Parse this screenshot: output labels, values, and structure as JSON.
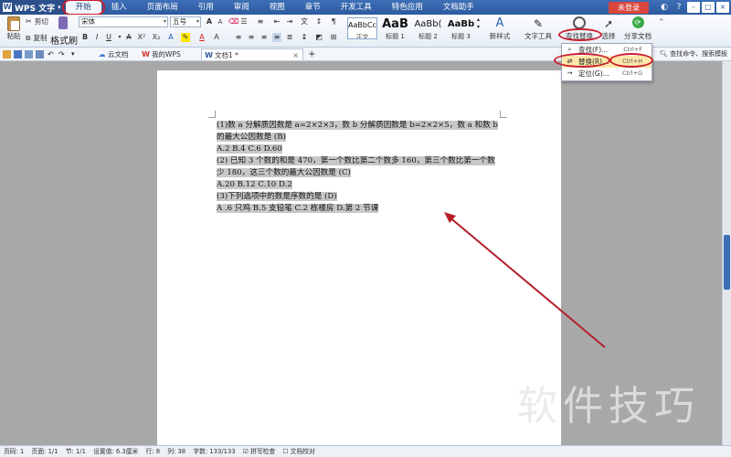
{
  "titlebar": {
    "app_name": "WPS 文字",
    "tabs": [
      "开始",
      "插入",
      "页面布局",
      "引用",
      "审阅",
      "视图",
      "章节",
      "开发工具",
      "特色应用",
      "文档助手"
    ],
    "login": "未登录"
  },
  "ribbon": {
    "paste": "粘贴",
    "cut": "剪切",
    "copy": "复制",
    "format_painter": "格式刷",
    "font_name": "宋体",
    "font_size": "五号",
    "styles": [
      {
        "preview": "AaBbCcD",
        "caption": "正文"
      },
      {
        "preview": "AaB",
        "caption": "标题 1"
      },
      {
        "preview": "AaBb(",
        "caption": "标题 2"
      },
      {
        "preview": "AaBb",
        "caption": "标题 3"
      }
    ],
    "new_style": "新样式",
    "text_tools": "文字工具",
    "find_replace": "查找替换",
    "select": "选择",
    "share_doc": "分享文档",
    "search_placeholder": "查找命令、搜索模板"
  },
  "dropdown": {
    "items": [
      {
        "label": "查找(F)...",
        "shortcut": "Ctrl+F"
      },
      {
        "label": "替换(R)...",
        "shortcut": "Ctrl+H"
      },
      {
        "label": "定位(G)...",
        "shortcut": "Ctrl+G"
      }
    ]
  },
  "tabs": {
    "cloud": "云文档",
    "my_wps": "我的WPS",
    "doc": "文档1 *"
  },
  "document": {
    "lines": [
      "(1)数 a 分解质因数是 a=2×2×3，数 b 分解质因数是 b=2×2×5，数 a 和数 b",
      "的最大公因数是 (B)",
      "A.2  B.4  C.6  D.60",
      "(2) 已知 3 个数的和是 470，第一个数比第二个数多 160，第三个数比第一个数",
      "少 180，这三个数的最大公因数是 (C)",
      "A.20  B.12  C.10  D.2",
      "(3)下列选项中的数是序数的是 (D)",
      "A .6 只鸡    B.5 支铅笔    C.2 栋楼房    D.第 2 节课"
    ]
  },
  "status": {
    "items": [
      "页码: 1",
      "页面: 1/1",
      "节: 1/1",
      "设置值: 6.3厘米",
      "行: 8",
      "列: 38",
      "字数: 133/133",
      "☑ 拼写检查",
      "☐ 文档校对"
    ]
  },
  "watermark": "软件技巧",
  "colors": {
    "accent": "#2c5a9f",
    "annotation": "#c8202e",
    "highlight": "#c8c8c8"
  }
}
